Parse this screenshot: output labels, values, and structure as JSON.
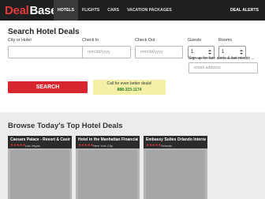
{
  "header": {
    "logo_deal": "Deal",
    "logo_base": "Base",
    "nav": [
      "HOTELS",
      "FLIGHTS",
      "CARS",
      "VACATION PACKAGES"
    ],
    "active_nav": "HOTELS",
    "deal_alerts": "DEAL ALERTS"
  },
  "search": {
    "title": "Search Hotel Deals",
    "city_label": "City or Hotel",
    "city_value": "",
    "checkin_label": "Check In",
    "checkin_placeholder": "mm/dd/yyyy",
    "checkout_label": "Check Out",
    "checkout_placeholder": "mm/dd/yyyy",
    "guests_label": "Guests",
    "guests_value": "1",
    "rooms_label": "Rooms",
    "rooms_value": "1",
    "signup_text": "Sign up for fare alerts & last minute ...",
    "email_placeholder": "email address",
    "search_button": "SEARCH",
    "promo_line": "Call for even better deals!",
    "promo_phone": "888-323-1174"
  },
  "deals": {
    "title": "Browse Today's Top Hotel Deals",
    "cards": [
      {
        "name": "Caesars Palace - Resort & Casino",
        "stars": "★★★★★",
        "location": "Las Vegas"
      },
      {
        "name": "Hotel in the Manhattan Financial ...",
        "stars": "★★★★★",
        "location": "New York City"
      },
      {
        "name": "Embassy Suites Orlando Internati...",
        "stars": "★★★★★",
        "location": "Orlando"
      }
    ]
  },
  "colors": {
    "brand_red": "#e03a3a",
    "header_bg": "#1f1f1f",
    "search_button": "#d7262d",
    "promo_bg": "#f4f0a8"
  }
}
